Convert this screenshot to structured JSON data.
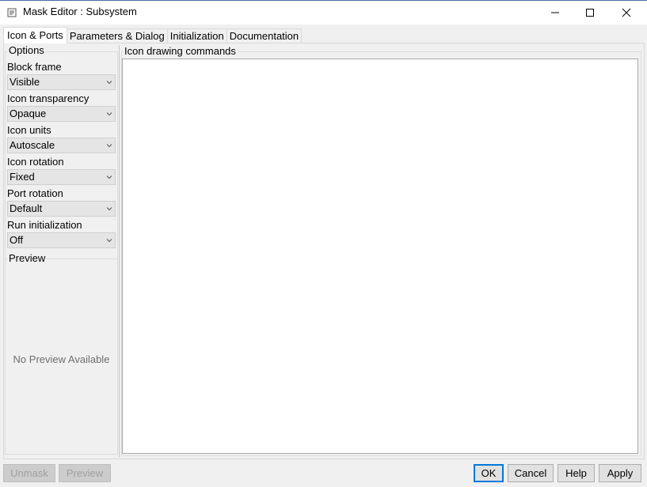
{
  "window": {
    "title": "Mask Editor : Subsystem",
    "app_icon": "simulink-mask-icon"
  },
  "tabs": [
    {
      "label": "Icon & Ports",
      "active": true
    },
    {
      "label": "Parameters & Dialog",
      "active": false
    },
    {
      "label": "Initialization",
      "active": false
    },
    {
      "label": "Documentation",
      "active": false
    }
  ],
  "options": {
    "group_title": "Options",
    "fields": [
      {
        "label": "Block frame",
        "value": "Visible"
      },
      {
        "label": "Icon transparency",
        "value": "Opaque"
      },
      {
        "label": "Icon units",
        "value": "Autoscale"
      },
      {
        "label": "Icon rotation",
        "value": "Fixed"
      },
      {
        "label": "Port rotation",
        "value": "Default"
      },
      {
        "label": "Run initialization",
        "value": "Off"
      }
    ]
  },
  "preview": {
    "title": "Preview",
    "empty_text": "No Preview Available"
  },
  "commands": {
    "title": "Icon drawing commands",
    "value": ""
  },
  "buttons": {
    "unmask": "Unmask",
    "preview": "Preview",
    "ok": "OK",
    "cancel": "Cancel",
    "help": "Help",
    "apply": "Apply"
  },
  "colors": {
    "default_button_border": "#0078d7",
    "window_bg": "#f0f0f0"
  }
}
